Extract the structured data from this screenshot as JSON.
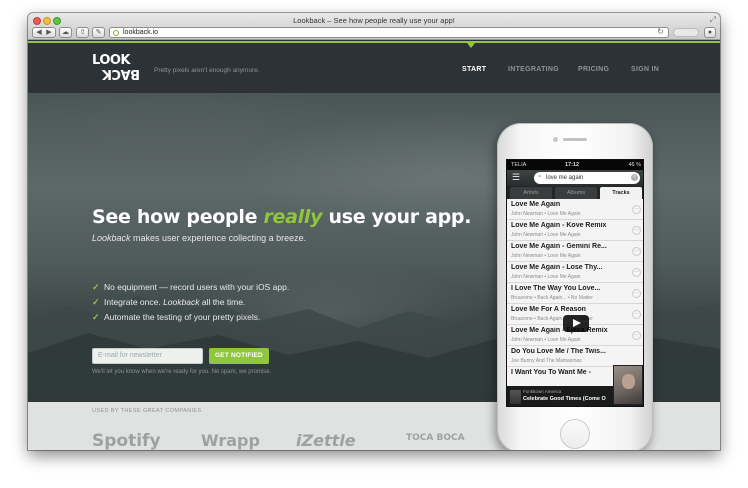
{
  "window": {
    "title": "Lookback – See how people really use your app!",
    "url": "lookback.io"
  },
  "nav": {
    "logo_top": "LOOK",
    "logo_bottom": "BACK",
    "tagline": "Pretty pixels aren't enough anymore.",
    "links": [
      "START",
      "INTEGRATING",
      "PRICING",
      "SIGN IN"
    ],
    "active": "START"
  },
  "hero": {
    "headline_before": "See how people ",
    "headline_highlight": "really",
    "headline_after": " use your app.",
    "sub_em": "Lookback",
    "sub_rest": " makes user experience collecting a breeze.",
    "features": [
      {
        "check": "✓",
        "text": "No equipment — record users with your iOS app."
      },
      {
        "check": "✓",
        "text": "Integrate once. ",
        "em": "Lookback",
        "text2": " all the time."
      },
      {
        "check": "✓",
        "text": "Automate the testing of your pretty pixels."
      }
    ],
    "email_placeholder": "E-mail for newsletter",
    "notify_label": "GET NOTIFIED",
    "notify_note": "We'll let you know when we're ready for you. No spam, we promise."
  },
  "companies": {
    "label": "USED BY THESE GREAT COMPANIES",
    "logos": [
      "Spotify",
      "Wrapp",
      "iZettle",
      "TOCA BOCA"
    ]
  },
  "phone": {
    "status": {
      "carrier": "TELIA",
      "time": "17:12",
      "battery": "46 %"
    },
    "search_value": "love me again",
    "tabs": [
      "Artists",
      "Albums",
      "Tracks"
    ],
    "active_tab": "Tracks",
    "tracks": [
      {
        "title": "Love Me Again",
        "sub": "John Newman • Love Me Again"
      },
      {
        "title": "Love Me Again - Kove Remix",
        "sub": "John Newman • Love Me Again"
      },
      {
        "title": "Love Me Again - Gemini Re...",
        "sub": "John Newman • Love Me Again"
      },
      {
        "title": "Love Me Again - Lose Thy...",
        "sub": "John Newman • Love Me Again"
      },
      {
        "title": "I Love The Way You Love...",
        "sub": "Bruuoone • Back Again... • No Matter"
      },
      {
        "title": "Love Me For A Reason",
        "sub": "Bruuoone • Back Again... • No Matter"
      },
      {
        "title": "Love Me Again - Ejeca Remix",
        "sub": "John Newman • Love Me Again"
      },
      {
        "title": "Do You Love Me / The Twis...",
        "sub": "Joe Bunny And The Mamasmas"
      },
      {
        "title": "I Want You To Want Me -",
        "sub": ""
      }
    ],
    "now_playing": {
      "artist": "Funkttown America",
      "title": "Celebrate Good Times (Come O"
    }
  },
  "colors": {
    "accent": "#8fc63d",
    "nav_bg": "#2d3236"
  }
}
